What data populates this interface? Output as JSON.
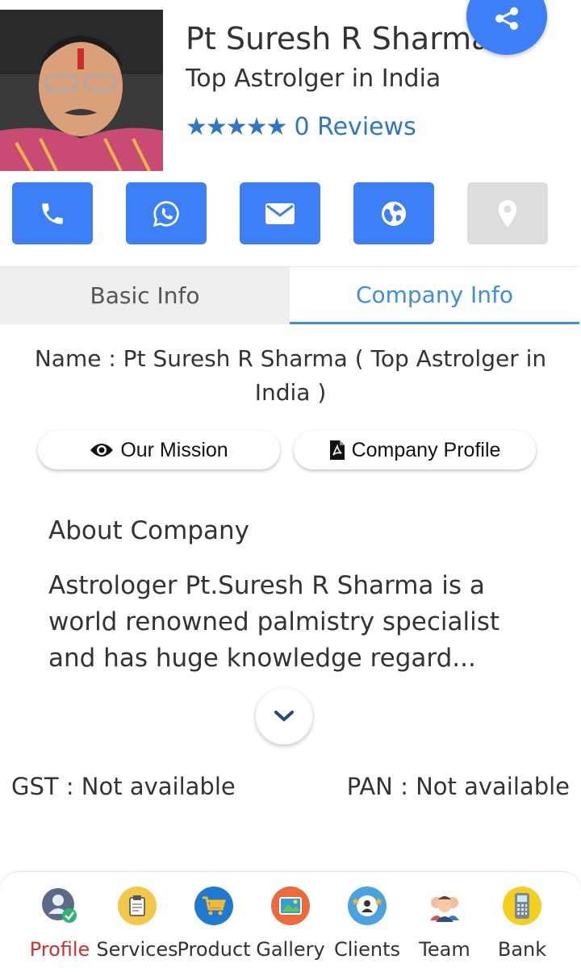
{
  "header": {
    "name": "Pt Suresh R Sharma",
    "tagline": "Top Astrolger in India",
    "stars": "★★★★★",
    "reviews": "0 Reviews"
  },
  "actions": [
    {
      "icon": "phone-icon"
    },
    {
      "icon": "whatsapp-icon"
    },
    {
      "icon": "email-icon"
    },
    {
      "icon": "globe-icon"
    },
    {
      "icon": "location-icon"
    }
  ],
  "tabs": {
    "basic": "Basic Info",
    "company": "Company Info"
  },
  "company": {
    "name_line": "Name : Pt Suresh R Sharma ( Top Astrolger in India )",
    "mission_label": "Our Mission",
    "profile_label": "Company Profile",
    "about_title": "About Company",
    "about_text": "Astrologer Pt.Suresh R Sharma is a world renowned palmistry specialist and has huge knowledge regard...",
    "gst": "GST : Not available",
    "pan": "PAN : Not available"
  },
  "bottom_nav": [
    {
      "label": "Profile",
      "active": true
    },
    {
      "label": "Services"
    },
    {
      "label": "Product"
    },
    {
      "label": "Gallery"
    },
    {
      "label": "Clients"
    },
    {
      "label": "Team"
    },
    {
      "label": "Bank"
    }
  ],
  "colors": {
    "accent": "#3d7ff7",
    "star": "#2f77c2",
    "tab_active": "#3d8ee0",
    "nav_active": "#d32f2f"
  }
}
